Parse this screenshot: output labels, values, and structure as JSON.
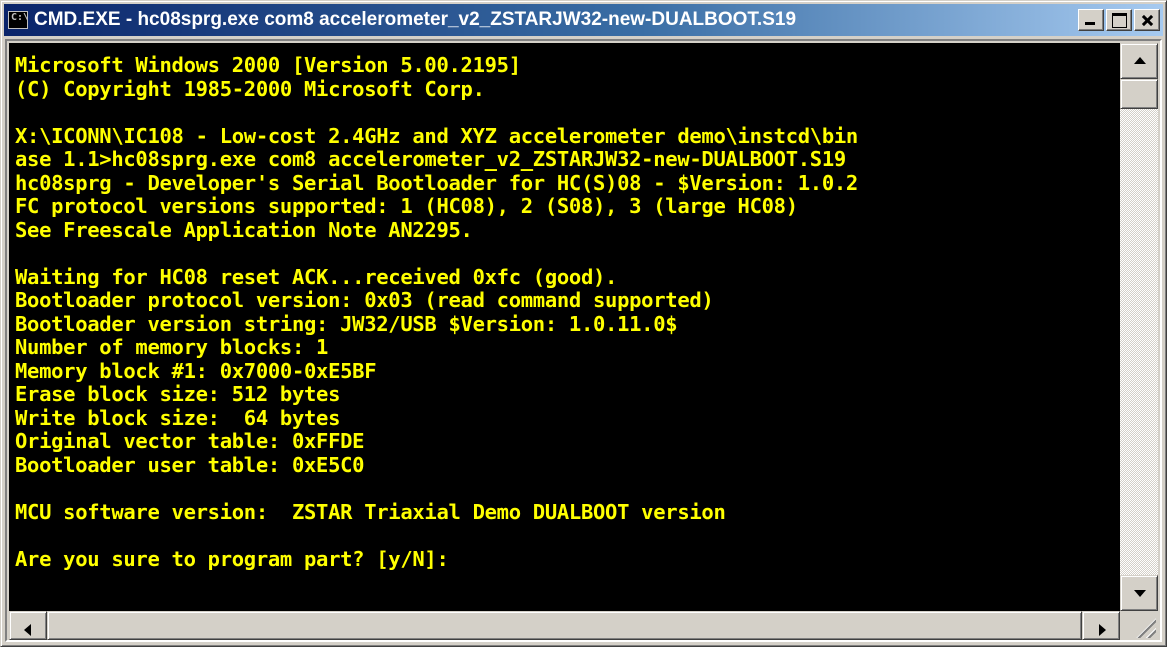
{
  "window": {
    "title": "CMD.EXE - hc08sprg.exe com8 accelerometer_v2_ZSTARJW32-new-DUALBOOT.S19",
    "icon": "console-icon",
    "icon_text": "C:\\"
  },
  "console": {
    "text_color": "#ffff00",
    "background_color": "#000000",
    "lines": [
      "Microsoft Windows 2000 [Version 5.00.2195]",
      "(C) Copyright 1985-2000 Microsoft Corp.",
      "",
      "X:\\ICONN\\IC108 - Low-cost 2.4GHz and XYZ accelerometer demo\\instcd\\bin",
      "ase 1.1>hc08sprg.exe com8 accelerometer_v2_ZSTARJW32-new-DUALBOOT.S19",
      "hc08sprg - Developer's Serial Bootloader for HC(S)08 - $Version: 1.0.2",
      "FC protocol versions supported: 1 (HC08), 2 (S08), 3 (large HC08)",
      "See Freescale Application Note AN2295.",
      "",
      "Waiting for HC08 reset ACK...received 0xfc (good).",
      "Bootloader protocol version: 0x03 (read command supported)",
      "Bootloader version string: JW32/USB $Version: 1.0.11.0$",
      "Number of memory blocks: 1",
      "Memory block #1: 0x7000-0xE5BF",
      "Erase block size: 512 bytes",
      "Write block size:  64 bytes",
      "Original vector table: 0xFFDE",
      "Bootloader user table: 0xE5C0",
      "",
      "MCU software version:  ZSTAR Triaxial Demo DUALBOOT version",
      "",
      "Are you sure to program part? [y/N]:"
    ]
  }
}
